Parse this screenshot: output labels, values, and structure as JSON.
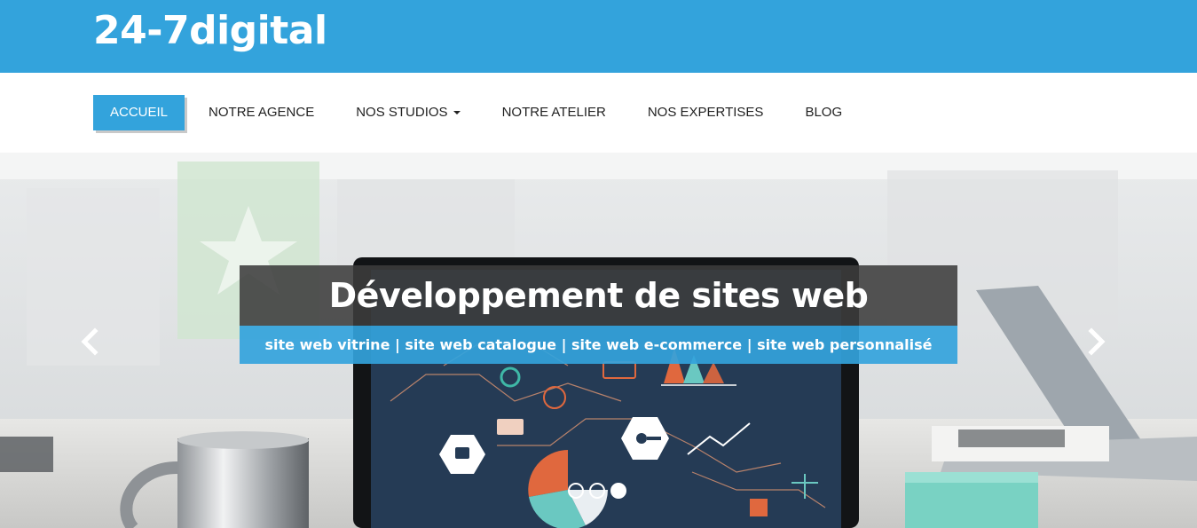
{
  "brand": {
    "logo_text": "24-7digital"
  },
  "nav": {
    "items": [
      {
        "label": "ACCUEIL",
        "active": true
      },
      {
        "label": "NOTRE AGENCE",
        "active": false
      },
      {
        "label": "NOS STUDIOS",
        "active": false,
        "has_dropdown": true
      },
      {
        "label": "NOTRE ATELIER",
        "active": false
      },
      {
        "label": "NOS EXPERTISES",
        "active": false
      },
      {
        "label": "BLOG",
        "active": false
      }
    ]
  },
  "hero": {
    "title": "Développement de sites web",
    "subtitle": "site web vitrine | site web catalogue | site web e-commerce | site web personnalisé",
    "prev_icon": "chevron-left-icon",
    "next_icon": "chevron-right-icon",
    "slide_count": 3,
    "active_slide": 3
  },
  "colors": {
    "brand_blue": "#33a3dc",
    "caption_dark": "#3c3c3c",
    "white": "#ffffff"
  }
}
